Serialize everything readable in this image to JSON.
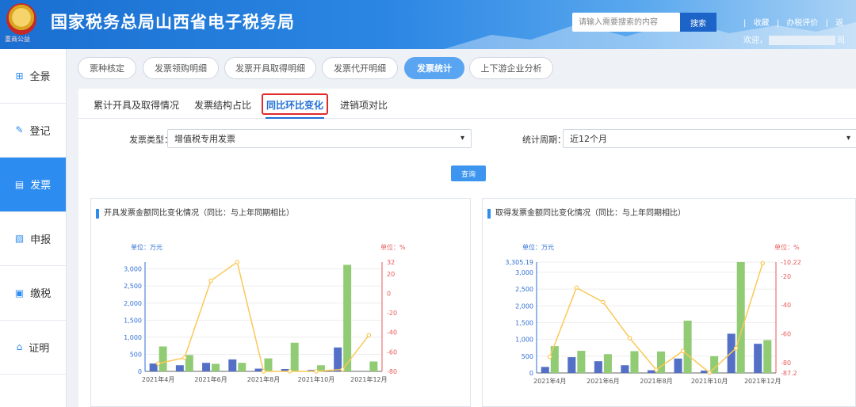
{
  "header": {
    "title": "国家税务总局山西省电子税务局",
    "emblem_text": "重商公益",
    "search_placeholder": "请输入需要搜索的内容",
    "search_label": "搜索",
    "links": [
      "|",
      "收藏",
      "|",
      "办税评价",
      "|",
      "返"
    ],
    "welcome_prefix": "欢迎，",
    "welcome_suffix": "司"
  },
  "sidebar": {
    "items": [
      {
        "label": "全景",
        "icon": "grid-icon",
        "active": false
      },
      {
        "label": "登记",
        "icon": "edit-icon",
        "active": false
      },
      {
        "label": "发票",
        "icon": "invoice-icon",
        "active": true
      },
      {
        "label": "申报",
        "icon": "chart-icon",
        "active": false
      },
      {
        "label": "缴税",
        "icon": "book-icon",
        "active": false
      },
      {
        "label": "证明",
        "icon": "certificate-icon",
        "active": false
      }
    ]
  },
  "pills": [
    {
      "label": "票种核定",
      "active": false
    },
    {
      "label": "发票领购明细",
      "active": false
    },
    {
      "label": "发票开具取得明细",
      "active": false
    },
    {
      "label": "发票代开明细",
      "active": false
    },
    {
      "label": "发票统计",
      "active": true
    },
    {
      "label": "上下游企业分析",
      "active": false
    }
  ],
  "subtabs": [
    {
      "label": "累计开具及取得情况",
      "active": false
    },
    {
      "label": "发票结构占比",
      "active": false
    },
    {
      "label": "同比环比变化",
      "active": true
    },
    {
      "label": "进销项对比",
      "active": false
    }
  ],
  "filters": {
    "type_label": "发票类型：",
    "type_value": "增值税专用发票",
    "period_label": "统计周期：",
    "period_value": "近12个月",
    "query_label": "查询"
  },
  "colors": {
    "bar_blue": "#5470c6",
    "bar_green": "#91cc75",
    "line_yellow": "#fac858",
    "left_axis": "#2f6fd6",
    "right_axis": "#e85a5a"
  },
  "chart_data": [
    {
      "type": "bar",
      "title": "开具发票金额同比变化情况（同比：与上年同期相比）",
      "left_unit": "单位：万元",
      "right_unit": "单位：%",
      "x_labels": [
        "2021年4月",
        "2021年6月",
        "2021年8月",
        "2021年10月",
        "2021年12月"
      ],
      "categories": [
        "2021年4月",
        "2021年5月",
        "2021年6月",
        "2021年7月",
        "2021年8月",
        "2021年9月",
        "2021年10月",
        "2021年11月",
        "2021年12月"
      ],
      "left_ticks": [
        "0",
        "500",
        "1,000",
        "1,500",
        "2,000",
        "2,500",
        "3,000"
      ],
      "right_ticks": [
        "-80",
        "-60",
        "-40",
        "-20",
        "0",
        "20",
        "32"
      ],
      "ylim": [
        0,
        3200
      ],
      "y2lim": [
        -80,
        32
      ],
      "series": [
        {
          "kind": "bar",
          "values": [
            230,
            180,
            250,
            350,
            80,
            70,
            40,
            700,
            0
          ]
        },
        {
          "kind": "bar",
          "values": [
            730,
            480,
            220,
            250,
            380,
            840,
            180,
            3120,
            290
          ]
        },
        {
          "kind": "line",
          "axis": "right",
          "values": [
            -72,
            -66,
            13,
            32,
            -80,
            -80,
            -80,
            -78,
            -43
          ]
        }
      ]
    },
    {
      "type": "bar",
      "title": "取得发票金额同比变化情况（同比：与上年同期相比）",
      "left_unit": "单位：万元",
      "right_unit": "单位：%",
      "x_labels": [
        "2021年4月",
        "2021年6月",
        "2021年8月",
        "2021年10月",
        "2021年12月"
      ],
      "categories": [
        "2021年4月",
        "2021年5月",
        "2021年6月",
        "2021年7月",
        "2021年8月",
        "2021年9月",
        "2021年10月",
        "2021年11月",
        "2021年12月"
      ],
      "left_ticks": [
        "0",
        "500",
        "1,000",
        "1,500",
        "2,000",
        "2,500",
        "3,000",
        "3,305.19"
      ],
      "right_ticks": [
        "-87.2",
        "-80",
        "-60",
        "-40",
        "-20",
        "-10.22"
      ],
      "ylim": [
        0,
        3305.19
      ],
      "y2lim": [
        -87.2,
        -10.22
      ],
      "series": [
        {
          "kind": "bar",
          "values": [
            180,
            470,
            350,
            230,
            80,
            430,
            70,
            1170,
            870
          ]
        },
        {
          "kind": "bar",
          "values": [
            800,
            660,
            560,
            650,
            640,
            1560,
            500,
            3305.19,
            980
          ]
        },
        {
          "kind": "line",
          "axis": "right",
          "values": [
            -76,
            -28,
            -38,
            -63,
            -85,
            -72,
            -87,
            -70,
            -11
          ]
        }
      ]
    }
  ]
}
